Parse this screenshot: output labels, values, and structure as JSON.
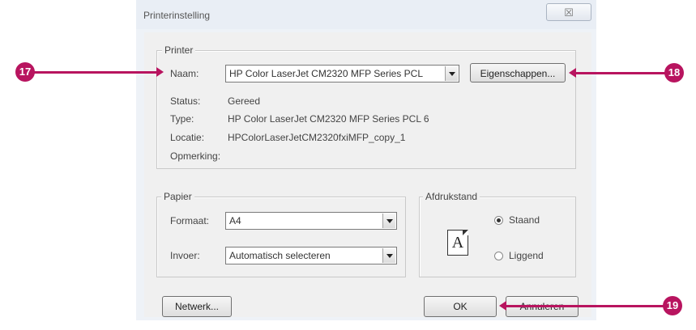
{
  "dialog": {
    "title": "Printerinstelling",
    "close_glyph": "☒"
  },
  "printer": {
    "legend": "Printer",
    "name_label": "Naam:",
    "name_value": "HP Color LaserJet CM2320 MFP Series PCL",
    "properties_button": "Eigenschappen...",
    "status_label": "Status:",
    "status_value": "Gereed",
    "type_label": "Type:",
    "type_value": "HP Color LaserJet CM2320 MFP Series PCL 6",
    "location_label": "Locatie:",
    "location_value": "HPColorLaserJetCM2320fxiMFP_copy_1",
    "comment_label": "Opmerking:"
  },
  "paper": {
    "legend": "Papier",
    "size_label": "Formaat:",
    "size_value": "A4",
    "source_label": "Invoer:",
    "source_value": "Automatisch selecteren"
  },
  "orientation": {
    "legend": "Afdrukstand",
    "icon_letter": "A",
    "portrait_label": "Staand",
    "landscape_label": "Liggend",
    "selected": "Staand"
  },
  "buttons": {
    "network": "Netwerk...",
    "ok": "OK",
    "cancel": "Annuleren"
  },
  "callouts": {
    "c17": "17",
    "c18": "18",
    "c19": "19",
    "color": "#b8145f"
  }
}
